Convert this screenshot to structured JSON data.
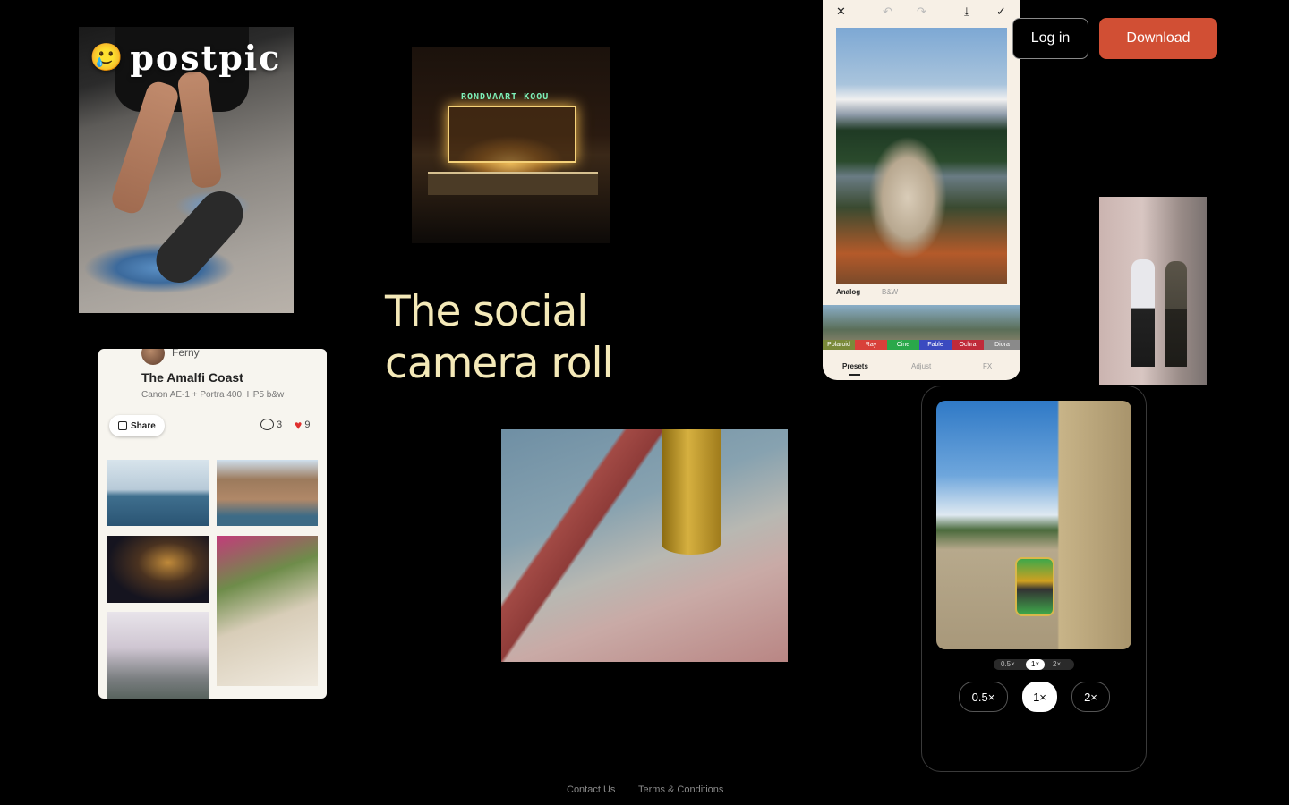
{
  "brand": {
    "name": "postpic",
    "icon": "camera-emoji-icon"
  },
  "hero": {
    "tagline_line1": "The social",
    "tagline_line2": "camera roll"
  },
  "nav": {
    "login": "Log in",
    "download": "Download"
  },
  "colors": {
    "background": "#000000",
    "accent": "#d14f34",
    "tagline": "#f4e9b8"
  },
  "night_photo": {
    "sign": "RONDVAART KOOU"
  },
  "post_card": {
    "author": "Ferny",
    "title": "The Amalfi Coast",
    "subtitle": "Canon AE-1 + Portra 400, HP5 b&w",
    "share": "Share",
    "comments": "3",
    "likes": "9"
  },
  "editor": {
    "tab_analog": "Analog",
    "tab_bw": "B&W",
    "presets": [
      "Polaroid",
      "Ray",
      "Cine",
      "Fable",
      "Ochra",
      "Diora"
    ],
    "preset_colors": [
      "#7a8a3a",
      "#d8403a",
      "#2aa84a",
      "#3a4ac0",
      "#c02a3a",
      "#8a8a8a"
    ],
    "bottom_tabs": [
      "Presets",
      "Adjust",
      "FX"
    ]
  },
  "camera": {
    "mini_zoom": [
      "0.5×",
      "1×",
      "2×"
    ],
    "zoom_options": [
      "0.5×",
      "1×",
      "2×"
    ],
    "active_zoom": "1×"
  },
  "footer": {
    "contact": "Contact Us",
    "terms": "Terms & Conditions"
  }
}
